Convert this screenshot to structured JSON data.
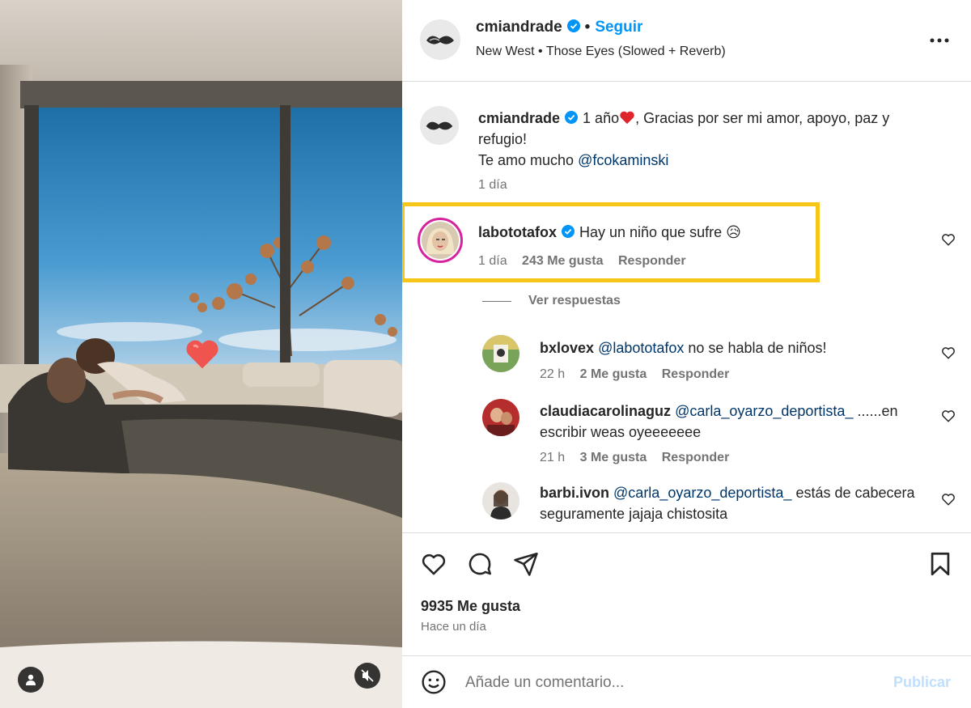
{
  "post": {
    "author": "cmiandrade",
    "follow_label": "Seguir",
    "separator": "•",
    "audio": "New West • Those Eyes (Slowed + Reverb)"
  },
  "caption": {
    "author": "cmiandrade",
    "text_part1": "1 año",
    "text_part2": ", Gracias por ser mi amor, apoyo, paz y refugio!",
    "line2_prefix": "Te amo mucho ",
    "mention": "@fcokaminski",
    "time": "1 día"
  },
  "comments": [
    {
      "author": "labototafox",
      "text": "Hay un niño que sufre",
      "emoji": "😥",
      "time": "1 día",
      "likes": "243 Me gusta",
      "reply_label": "Responder"
    }
  ],
  "view_replies_label": "Ver respuestas",
  "replies": [
    {
      "author": "bxlovex",
      "mention": "@labototafox",
      "text": " no se habla de niños!",
      "time": "22 h",
      "likes": "2 Me gusta",
      "reply_label": "Responder"
    },
    {
      "author": "claudiacarolinaguz",
      "mention": "@carla_oyarzo_deportista_",
      "text": " ......en escribir weas oyeeeeeee",
      "time": "21 h",
      "likes": "3 Me gusta",
      "reply_label": "Responder"
    },
    {
      "author": "barbi.ivon",
      "mention": "@carla_oyarzo_deportista_",
      "text": " estás de cabecera seguramente jajaja chistosita"
    }
  ],
  "footer": {
    "likes": "9935 Me gusta",
    "time_ago": "Hace un día",
    "comment_placeholder": "Añade un comentario...",
    "publish_label": "Publicar"
  },
  "colors": {
    "accent": "#0095f6",
    "highlight": "#f5c518",
    "mention": "#00376b",
    "muted": "#737373"
  },
  "icons": {
    "like": "heart-icon",
    "comment": "comment-icon",
    "share": "send-icon",
    "save": "bookmark-icon",
    "more": "more-options-icon",
    "emoji": "emoji-icon",
    "mute": "audio-muted-icon",
    "tag": "user-tag-icon"
  }
}
